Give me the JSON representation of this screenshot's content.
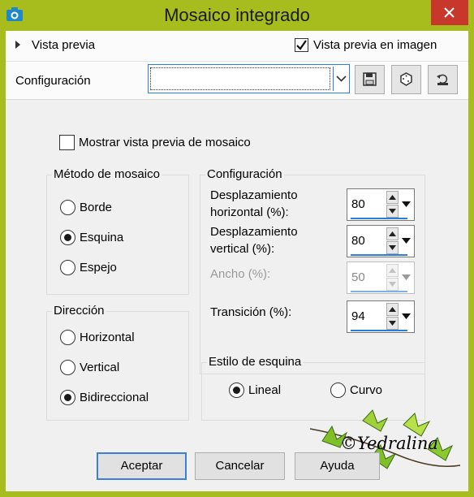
{
  "window": {
    "title": "Mosaico integrado"
  },
  "header": {
    "preview_label": "Vista previa",
    "preview_in_image_label": "Vista previa en imagen",
    "preview_in_image_checked": true,
    "config_label": "Configuración",
    "config_value": ""
  },
  "options": {
    "show_tile_preview_label": "Mostrar vista previa de mosaico",
    "show_tile_preview_checked": false
  },
  "tile_method": {
    "legend": "Método de mosaico",
    "options": [
      {
        "label": "Borde",
        "checked": false
      },
      {
        "label": "Esquina",
        "checked": true
      },
      {
        "label": "Espejo",
        "checked": false
      }
    ]
  },
  "direction": {
    "legend": "Dirección",
    "options": [
      {
        "label": "Horizontal",
        "checked": false
      },
      {
        "label": "Vertical",
        "checked": false
      },
      {
        "label": "Bidireccional",
        "checked": true
      }
    ]
  },
  "settings": {
    "legend": "Configuración",
    "fields": [
      {
        "label_line1": "Desplazamiento",
        "label_line2": "horizontal (%):",
        "value": "80",
        "enabled": true
      },
      {
        "label_line1": "Desplazamiento",
        "label_line2": "vertical (%):",
        "value": "80",
        "enabled": true
      },
      {
        "label_line1": "Ancho (%):",
        "label_line2": "",
        "value": "50",
        "enabled": false
      },
      {
        "label_line1": "Transición (%):",
        "label_line2": "",
        "value": "94",
        "enabled": true
      }
    ]
  },
  "corner_style": {
    "legend": "Estilo de esquina",
    "options": [
      {
        "label": "Lineal",
        "checked": true
      },
      {
        "label": "Curvo",
        "checked": false
      }
    ]
  },
  "watermark": {
    "text": "©Yedralina"
  },
  "buttons": {
    "ok": "Aceptar",
    "cancel": "Cancelar",
    "help": "Ayuda"
  }
}
